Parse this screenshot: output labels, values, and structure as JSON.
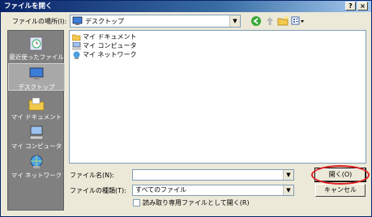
{
  "window": {
    "title": "ファイルを開く",
    "help": "?",
    "close": "×"
  },
  "lookin": {
    "label": "ファイルの場所(I):",
    "value": "デスクトップ"
  },
  "places": [
    {
      "label": "最近使ったファイル",
      "icon": "recent-icon"
    },
    {
      "label": "デスクトップ",
      "icon": "desktop-icon",
      "selected": true
    },
    {
      "label": "マイ ドキュメント",
      "icon": "my-documents-icon"
    },
    {
      "label": "マイ コンピュータ",
      "icon": "my-computer-icon"
    },
    {
      "label": "マイ ネットワーク",
      "icon": "my-network-icon"
    }
  ],
  "files": [
    {
      "name": "マイ ドキュメント",
      "icon": "folder-docs-icon"
    },
    {
      "name": "マイ コンピュータ",
      "icon": "computer-icon"
    },
    {
      "name": "マイ ネットワーク",
      "icon": "network-icon"
    }
  ],
  "filename": {
    "label": "ファイル名(N):",
    "value": ""
  },
  "filetype": {
    "label": "ファイルの種類(T):",
    "value": "すべてのファイル"
  },
  "readonly": {
    "label": "読み取り専用ファイルとして開く(R)",
    "checked": false
  },
  "buttons": {
    "open": "開く(O)",
    "cancel": "キャンセル"
  },
  "accent": {
    "titlebar": "#0a246a",
    "highlight_ring": "#e02020"
  }
}
